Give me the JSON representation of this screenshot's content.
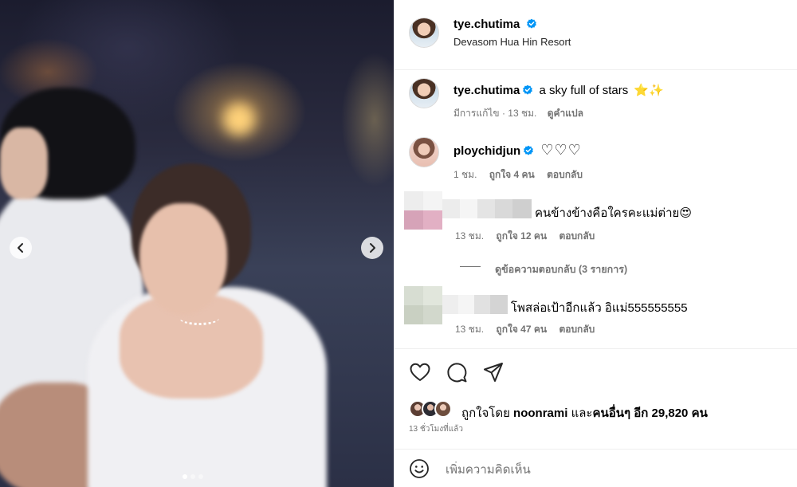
{
  "post": {
    "author": "tye.chutima",
    "location": "Devasom Hua Hin Resort",
    "caption_text": "a sky full of stars",
    "caption_emoji": "⭐✨",
    "caption_meta_edited": "มีการแก้ไข",
    "caption_meta_time": "13 ชม.",
    "caption_meta_translate": "ดูคำแปล",
    "carousel_index": 1,
    "carousel_count": 3
  },
  "comments": [
    {
      "username": "ploychidjun",
      "text": "♡♡♡",
      "time": "1 ชม.",
      "likes": "ถูกใจ 4 คน",
      "reply": "ตอบกลับ"
    },
    {
      "username": "",
      "text": "คนข้างข้างคือใครคะแม่ต่าย😍",
      "time": "13 ชม.",
      "likes": "ถูกใจ 12 คน",
      "reply": "ตอบกลับ",
      "view_replies": "ดูข้อความตอบกลับ (3 รายการ)"
    },
    {
      "username": "",
      "text": "โพสล่อเป้าอีกแล้ว อิแม่555555555",
      "time": "13 ชม.",
      "likes": "ถูกใจ 47 คน",
      "reply": "ตอบกลับ"
    }
  ],
  "likes_summary": {
    "prefix": "ถูกใจโดย",
    "user": "noonrami",
    "conjunction": "และ",
    "others": "คนอื่นๆ อีก 29,820 คน"
  },
  "posted_ago": "13 ชั่วโมงที่แล้ว",
  "comment_box": {
    "placeholder": "เพิ่มความคิดเห็น"
  },
  "icons": {
    "like": "heart-icon",
    "comment": "comment-icon",
    "share": "share-icon",
    "emoji": "emoji-icon",
    "verified": "verified-badge-icon",
    "prev": "chevron-left-icon",
    "next": "chevron-right-icon"
  },
  "colors": {
    "verified": "#0095f6",
    "meta": "#737373",
    "divider": "#efefef"
  }
}
